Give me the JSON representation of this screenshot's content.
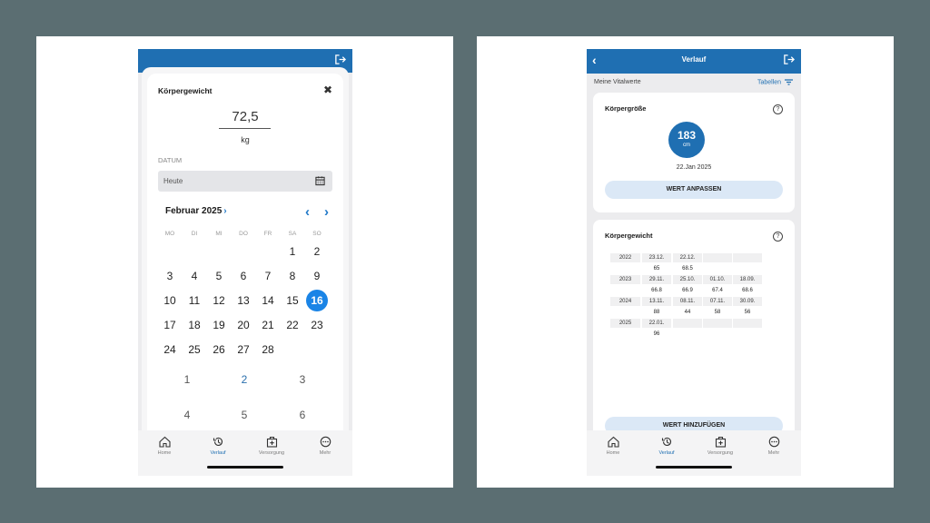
{
  "left": {
    "modal_title": "Körpergewicht",
    "close_glyph": "✖",
    "weight_value": "72,5",
    "weight_unit": "kg",
    "date_label": "DATUM",
    "date_input_value": "Heute",
    "month_title": "Februar 2025",
    "month_chevron": "›",
    "nav_prev": "‹",
    "nav_next": "›",
    "weekdays": [
      "MO",
      "DI",
      "MI",
      "DO",
      "FR",
      "SA",
      "SO"
    ],
    "days": [
      "1",
      "2",
      "3",
      "4",
      "5",
      "6",
      "7",
      "8",
      "9",
      "10",
      "11",
      "12",
      "13",
      "14",
      "15",
      "16",
      "17",
      "18",
      "19",
      "20",
      "21",
      "22",
      "23",
      "24",
      "25",
      "26",
      "27",
      "28"
    ],
    "selected_day": "16",
    "year_wheel": [
      "1",
      "2",
      "3",
      "4",
      "5",
      "6"
    ]
  },
  "right": {
    "header_title": "Verlauf",
    "back_glyph": "‹",
    "section_label": "Meine Vitalwerte",
    "tables_link": "Tabellen",
    "height_card": {
      "title": "Körpergröße",
      "help": "?",
      "value": "183",
      "unit": "cm",
      "date": "22.Jan 2025",
      "button": "WERT ANPASSEN"
    },
    "weight_card": {
      "title": "Körpergewicht",
      "help": "?",
      "rows": [
        {
          "year": "2022",
          "cells": [
            {
              "d": "23.12.",
              "v": "65"
            },
            {
              "d": "22.12.",
              "v": "68.5"
            },
            {
              "d": "",
              "v": ""
            },
            {
              "d": "",
              "v": ""
            }
          ]
        },
        {
          "year": "2023",
          "cells": [
            {
              "d": "29.11.",
              "v": "66.8"
            },
            {
              "d": "25.10.",
              "v": "66.9"
            },
            {
              "d": "01.10.",
              "v": "67.4"
            },
            {
              "d": "18.09.",
              "v": "68.6"
            }
          ]
        },
        {
          "year": "2024",
          "cells": [
            {
              "d": "13.11.",
              "v": "88"
            },
            {
              "d": "08.11.",
              "v": "44"
            },
            {
              "d": "07.11.",
              "v": "58"
            },
            {
              "d": "30.09.",
              "v": "56"
            }
          ]
        },
        {
          "year": "2025",
          "cells": [
            {
              "d": "22.01.",
              "v": "96"
            },
            {
              "d": "",
              "v": ""
            },
            {
              "d": "",
              "v": ""
            },
            {
              "d": "",
              "v": ""
            }
          ]
        }
      ],
      "button": "WERT HINZUFÜGEN"
    }
  },
  "tabbar": {
    "items": [
      {
        "label": "Home",
        "icon": "home-icon"
      },
      {
        "label": "Verlauf",
        "icon": "history-icon"
      },
      {
        "label": "Versorgung",
        "icon": "medical-kit-icon"
      },
      {
        "label": "Mehr",
        "icon": "more-icon"
      }
    ],
    "active": "Verlauf"
  },
  "colors": {
    "brand_blue": "#1f6fb2",
    "selected_day": "#1a84e6",
    "button_bg": "#dbe8f6",
    "backdrop": "#5b6e72"
  }
}
